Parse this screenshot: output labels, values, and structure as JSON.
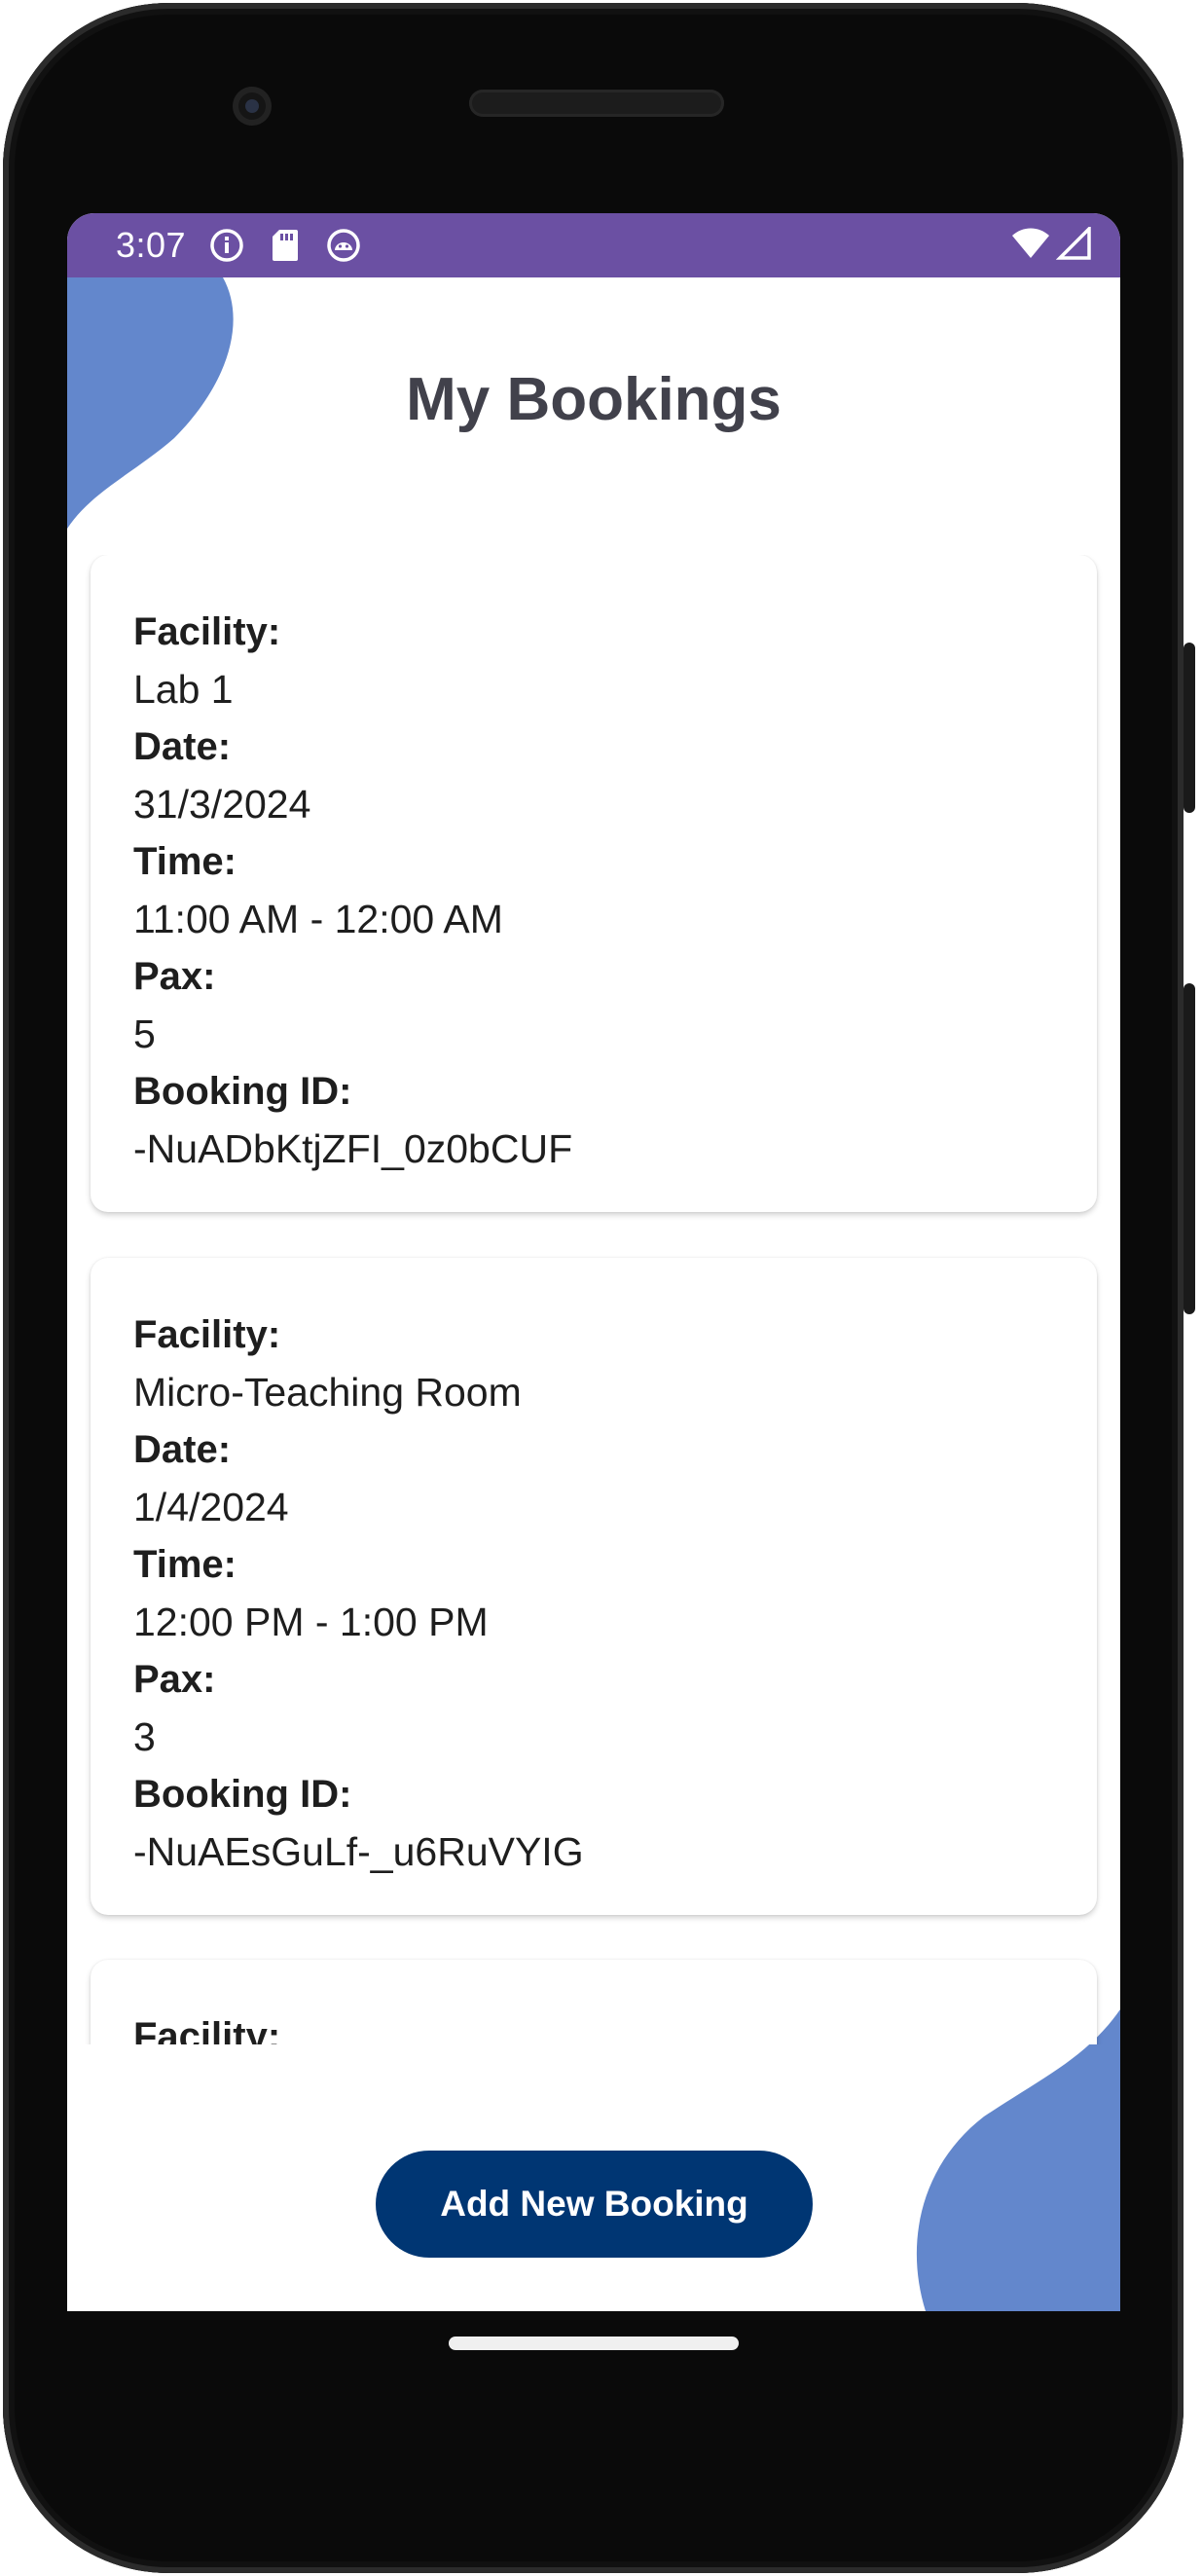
{
  "status_bar": {
    "time": "3:07",
    "icons": [
      "info-icon",
      "sd-card-icon",
      "android-debug-icon"
    ],
    "right_icons": [
      "wifi-icon",
      "cell-signal-icon"
    ],
    "color": "#6b50a3"
  },
  "page": {
    "title": "My Bookings",
    "accent_blob_color": "#6387cc"
  },
  "labels": {
    "facility": "Facility:",
    "date": "Date:",
    "time": "Time:",
    "pax": "Pax:",
    "booking_id": "Booking ID:"
  },
  "bookings": [
    {
      "facility": "Lab 1",
      "date": "31/3/2024",
      "time": "11:00 AM - 12:00 AM",
      "pax": "5",
      "booking_id": "-NuADbKtjZFI_0z0bCUF"
    },
    {
      "facility": "Micro-Teaching Room",
      "date": "1/4/2024",
      "time": "12:00 PM - 1:00 PM",
      "pax": "3",
      "booking_id": "-NuAEsGuLf-_u6RuVYIG"
    },
    {
      "facility": "",
      "date": "",
      "time": "",
      "pax": "",
      "booking_id": ""
    }
  ],
  "actions": {
    "add_label": "Add New Booking",
    "button_color": "#003673"
  }
}
